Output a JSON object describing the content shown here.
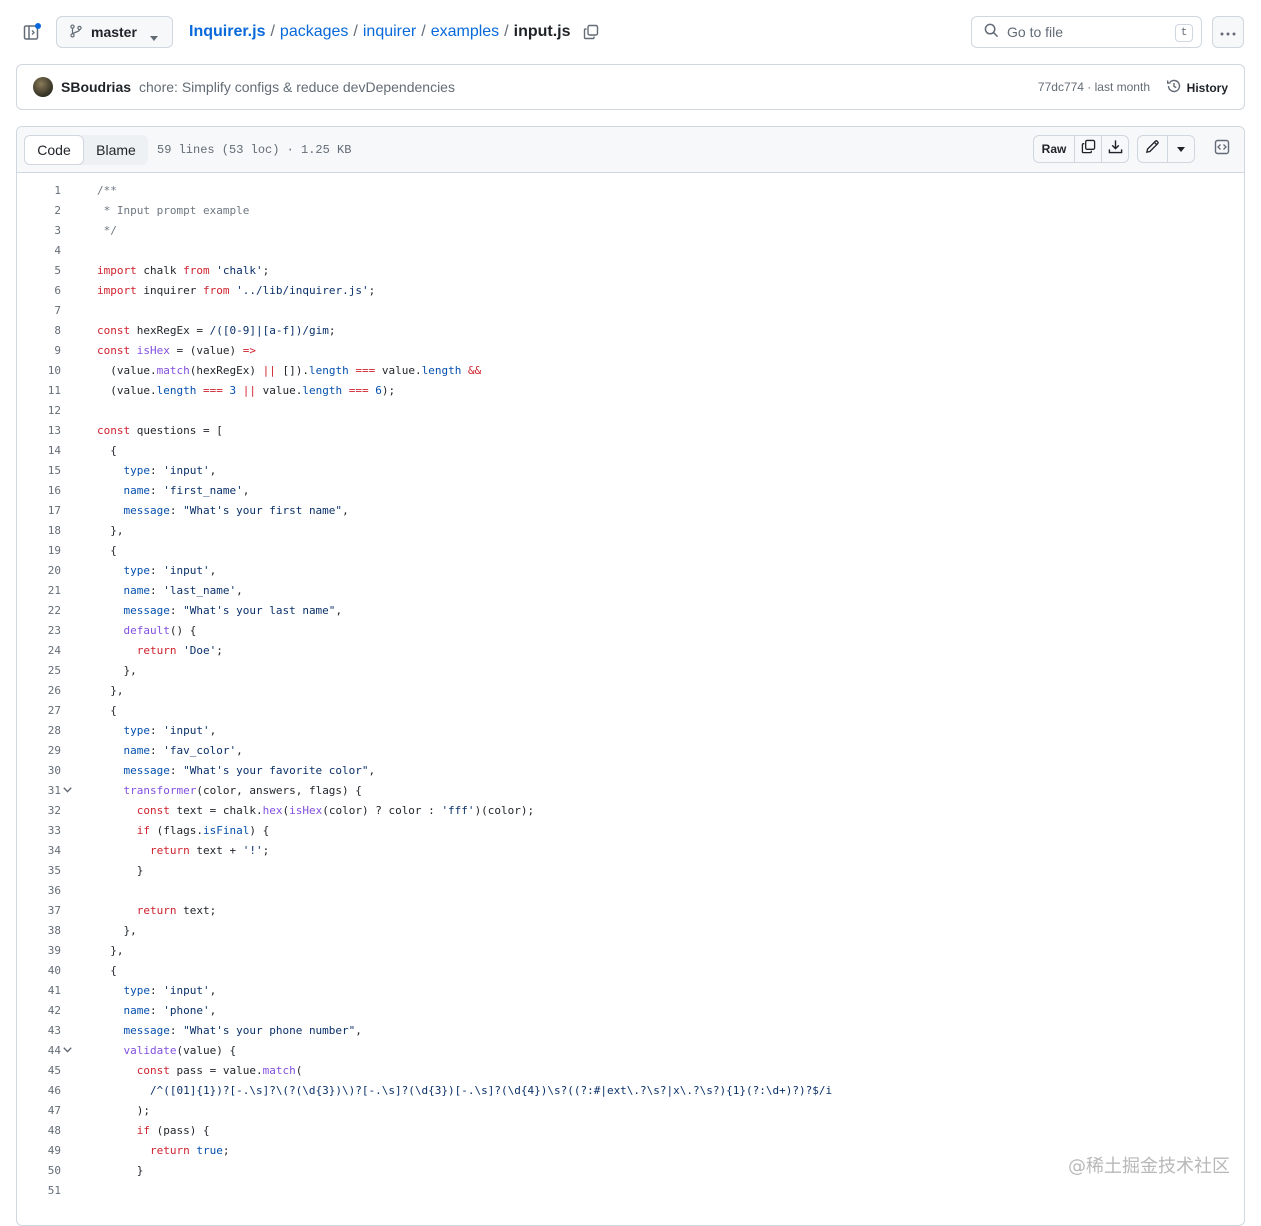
{
  "header": {
    "branch": "master",
    "breadcrumb": [
      "Inquirer.js",
      "packages",
      "inquirer",
      "examples"
    ],
    "separator": "/",
    "file_name": "input.js",
    "goto_placeholder": "Go to file",
    "goto_shortcut": "t"
  },
  "commit": {
    "author": "SBoudrias",
    "message": "chore: Simplify configs & reduce devDependencies",
    "meta": "77dc774 · last month",
    "history_label": "History"
  },
  "file": {
    "tab_code": "Code",
    "tab_blame": "Blame",
    "info": "59 lines (53 loc) · 1.25 KB",
    "raw_label": "Raw"
  },
  "code_lines": [
    [
      [
        "c",
        "/**"
      ]
    ],
    [
      [
        "c",
        " * Input prompt example"
      ]
    ],
    [
      [
        "c",
        " */"
      ]
    ],
    [],
    [
      [
        "k",
        "import"
      ],
      [
        "t",
        " chalk "
      ],
      [
        "k",
        "from"
      ],
      [
        "t",
        " "
      ],
      [
        "s",
        "'chalk'"
      ],
      [
        "t",
        ";"
      ]
    ],
    [
      [
        "k",
        "import"
      ],
      [
        "t",
        " inquirer "
      ],
      [
        "k",
        "from"
      ],
      [
        "t",
        " "
      ],
      [
        "s",
        "'../lib/inquirer.js'"
      ],
      [
        "t",
        ";"
      ]
    ],
    [],
    [
      [
        "k",
        "const"
      ],
      [
        "t",
        " hexRegEx = "
      ],
      [
        "s",
        "/([0-9]|[a-f])/gim"
      ],
      [
        "t",
        ";"
      ]
    ],
    [
      [
        "k",
        "const"
      ],
      [
        "t",
        " "
      ],
      [
        "f",
        "isHex"
      ],
      [
        "t",
        " = (value) "
      ],
      [
        "k",
        "=>"
      ]
    ],
    [
      [
        "t",
        "  (value."
      ],
      [
        "f",
        "match"
      ],
      [
        "t",
        "(hexRegEx) "
      ],
      [
        "k",
        "||"
      ],
      [
        "t",
        " [])."
      ],
      [
        "p",
        "length"
      ],
      [
        "t",
        " "
      ],
      [
        "k",
        "==="
      ],
      [
        "t",
        " value."
      ],
      [
        "p",
        "length"
      ],
      [
        "t",
        " "
      ],
      [
        "k",
        "&&"
      ]
    ],
    [
      [
        "t",
        "  (value."
      ],
      [
        "p",
        "length"
      ],
      [
        "t",
        " "
      ],
      [
        "k",
        "==="
      ],
      [
        "t",
        " "
      ],
      [
        "p",
        "3"
      ],
      [
        "t",
        " "
      ],
      [
        "k",
        "||"
      ],
      [
        "t",
        " value."
      ],
      [
        "p",
        "length"
      ],
      [
        "t",
        " "
      ],
      [
        "k",
        "==="
      ],
      [
        "t",
        " "
      ],
      [
        "p",
        "6"
      ],
      [
        "t",
        ");"
      ]
    ],
    [],
    [
      [
        "k",
        "const"
      ],
      [
        "t",
        " questions = ["
      ]
    ],
    [
      [
        "t",
        "  {"
      ]
    ],
    [
      [
        "t",
        "    "
      ],
      [
        "p",
        "type"
      ],
      [
        "t",
        ": "
      ],
      [
        "s",
        "'input'"
      ],
      [
        "t",
        ","
      ]
    ],
    [
      [
        "t",
        "    "
      ],
      [
        "p",
        "name"
      ],
      [
        "t",
        ": "
      ],
      [
        "s",
        "'first_name'"
      ],
      [
        "t",
        ","
      ]
    ],
    [
      [
        "t",
        "    "
      ],
      [
        "p",
        "message"
      ],
      [
        "t",
        ": "
      ],
      [
        "s",
        "\"What's your first name\""
      ],
      [
        "t",
        ","
      ]
    ],
    [
      [
        "t",
        "  },"
      ]
    ],
    [
      [
        "t",
        "  {"
      ]
    ],
    [
      [
        "t",
        "    "
      ],
      [
        "p",
        "type"
      ],
      [
        "t",
        ": "
      ],
      [
        "s",
        "'input'"
      ],
      [
        "t",
        ","
      ]
    ],
    [
      [
        "t",
        "    "
      ],
      [
        "p",
        "name"
      ],
      [
        "t",
        ": "
      ],
      [
        "s",
        "'last_name'"
      ],
      [
        "t",
        ","
      ]
    ],
    [
      [
        "t",
        "    "
      ],
      [
        "p",
        "message"
      ],
      [
        "t",
        ": "
      ],
      [
        "s",
        "\"What's your last name\""
      ],
      [
        "t",
        ","
      ]
    ],
    [
      [
        "t",
        "    "
      ],
      [
        "f",
        "default"
      ],
      [
        "t",
        "() {"
      ]
    ],
    [
      [
        "t",
        "      "
      ],
      [
        "k",
        "return"
      ],
      [
        "t",
        " "
      ],
      [
        "s",
        "'Doe'"
      ],
      [
        "t",
        ";"
      ]
    ],
    [
      [
        "t",
        "    },"
      ]
    ],
    [
      [
        "t",
        "  },"
      ]
    ],
    [
      [
        "t",
        "  {"
      ]
    ],
    [
      [
        "t",
        "    "
      ],
      [
        "p",
        "type"
      ],
      [
        "t",
        ": "
      ],
      [
        "s",
        "'input'"
      ],
      [
        "t",
        ","
      ]
    ],
    [
      [
        "t",
        "    "
      ],
      [
        "p",
        "name"
      ],
      [
        "t",
        ": "
      ],
      [
        "s",
        "'fav_color'"
      ],
      [
        "t",
        ","
      ]
    ],
    [
      [
        "t",
        "    "
      ],
      [
        "p",
        "message"
      ],
      [
        "t",
        ": "
      ],
      [
        "s",
        "\"What's your favorite color\""
      ],
      [
        "t",
        ","
      ]
    ],
    [
      [
        "t",
        "    "
      ],
      [
        "f",
        "transformer"
      ],
      [
        "t",
        "(color, answers, flags) {"
      ]
    ],
    [
      [
        "t",
        "      "
      ],
      [
        "k",
        "const"
      ],
      [
        "t",
        " text = chalk."
      ],
      [
        "f",
        "hex"
      ],
      [
        "t",
        "("
      ],
      [
        "f",
        "isHex"
      ],
      [
        "t",
        "(color) ? color : "
      ],
      [
        "s",
        "'fff'"
      ],
      [
        "t",
        ")(color);"
      ]
    ],
    [
      [
        "t",
        "      "
      ],
      [
        "k",
        "if"
      ],
      [
        "t",
        " (flags."
      ],
      [
        "p",
        "isFinal"
      ],
      [
        "t",
        ") {"
      ]
    ],
    [
      [
        "t",
        "        "
      ],
      [
        "k",
        "return"
      ],
      [
        "t",
        " text + "
      ],
      [
        "s",
        "'!'"
      ],
      [
        "t",
        ";"
      ]
    ],
    [
      [
        "t",
        "      }"
      ]
    ],
    [],
    [
      [
        "t",
        "      "
      ],
      [
        "k",
        "return"
      ],
      [
        "t",
        " text;"
      ]
    ],
    [
      [
        "t",
        "    },"
      ]
    ],
    [
      [
        "t",
        "  },"
      ]
    ],
    [
      [
        "t",
        "  {"
      ]
    ],
    [
      [
        "t",
        "    "
      ],
      [
        "p",
        "type"
      ],
      [
        "t",
        ": "
      ],
      [
        "s",
        "'input'"
      ],
      [
        "t",
        ","
      ]
    ],
    [
      [
        "t",
        "    "
      ],
      [
        "p",
        "name"
      ],
      [
        "t",
        ": "
      ],
      [
        "s",
        "'phone'"
      ],
      [
        "t",
        ","
      ]
    ],
    [
      [
        "t",
        "    "
      ],
      [
        "p",
        "message"
      ],
      [
        "t",
        ": "
      ],
      [
        "s",
        "\"What's your phone number\""
      ],
      [
        "t",
        ","
      ]
    ],
    [
      [
        "t",
        "    "
      ],
      [
        "f",
        "validate"
      ],
      [
        "t",
        "(value) {"
      ]
    ],
    [
      [
        "t",
        "      "
      ],
      [
        "k",
        "const"
      ],
      [
        "t",
        " pass = value."
      ],
      [
        "f",
        "match"
      ],
      [
        "t",
        "("
      ]
    ],
    [
      [
        "t",
        "        "
      ],
      [
        "s",
        "/^([01]{1})?[-.\\s]?\\(?(\\d{3})\\)?[-.\\s]?(\\d{3})[-.\\s]?(\\d{4})\\s?((?:#|ext\\.?\\s?|x\\.?\\s?){1}(?:\\d+)?)?$/i"
      ]
    ],
    [
      [
        "t",
        "      );"
      ]
    ],
    [
      [
        "t",
        "      "
      ],
      [
        "k",
        "if"
      ],
      [
        "t",
        " (pass) {"
      ]
    ],
    [
      [
        "t",
        "        "
      ],
      [
        "k",
        "return"
      ],
      [
        "t",
        " "
      ],
      [
        "p",
        "true"
      ],
      [
        "t",
        ";"
      ]
    ],
    [
      [
        "t",
        "      }"
      ]
    ],
    []
  ],
  "folded_lines": [
    31,
    44
  ],
  "watermark": "@稀土掘金技术社区"
}
